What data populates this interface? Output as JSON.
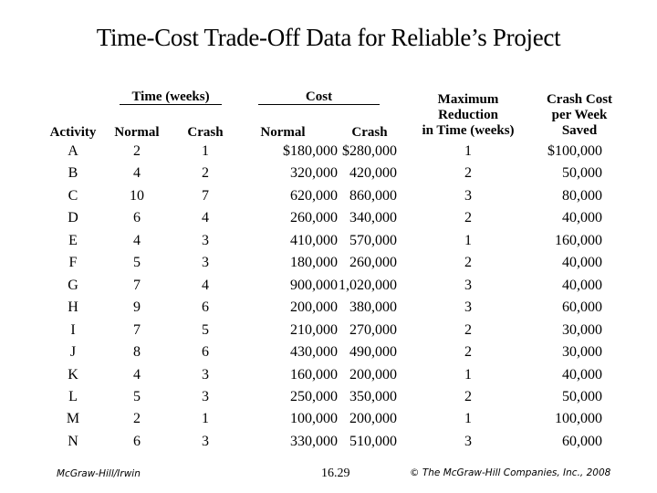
{
  "title": "Time-Cost Trade-Off Data for Reliable’s Project",
  "group_headers": {
    "time": "Time (weeks)",
    "cost": "Cost"
  },
  "column_headers": {
    "activity": "Activity",
    "time_normal": "Normal",
    "time_crash": "Crash",
    "cost_normal": "Normal",
    "cost_crash": "Crash",
    "max_reduction": [
      "Maximum",
      "Reduction",
      "in Time (weeks)"
    ],
    "crash_cost_per_week": [
      "Crash Cost",
      "per Week",
      "Saved"
    ]
  },
  "rows": [
    {
      "activity": "A",
      "time_normal": "2",
      "time_crash": "1",
      "cost_normal": "$180,000",
      "cost_crash": "$280,000",
      "max_reduction": "1",
      "crash_cost_per_week": "$100,000"
    },
    {
      "activity": "B",
      "time_normal": "4",
      "time_crash": "2",
      "cost_normal": "320,000",
      "cost_crash": "420,000",
      "max_reduction": "2",
      "crash_cost_per_week": "50,000"
    },
    {
      "activity": "C",
      "time_normal": "10",
      "time_crash": "7",
      "cost_normal": "620,000",
      "cost_crash": "860,000",
      "max_reduction": "3",
      "crash_cost_per_week": "80,000"
    },
    {
      "activity": "D",
      "time_normal": "6",
      "time_crash": "4",
      "cost_normal": "260,000",
      "cost_crash": "340,000",
      "max_reduction": "2",
      "crash_cost_per_week": "40,000"
    },
    {
      "activity": "E",
      "time_normal": "4",
      "time_crash": "3",
      "cost_normal": "410,000",
      "cost_crash": "570,000",
      "max_reduction": "1",
      "crash_cost_per_week": "160,000"
    },
    {
      "activity": "F",
      "time_normal": "5",
      "time_crash": "3",
      "cost_normal": "180,000",
      "cost_crash": "260,000",
      "max_reduction": "2",
      "crash_cost_per_week": "40,000"
    },
    {
      "activity": "G",
      "time_normal": "7",
      "time_crash": "4",
      "cost_normal": "900,000",
      "cost_crash": "1,020,000",
      "max_reduction": "3",
      "crash_cost_per_week": "40,000"
    },
    {
      "activity": "H",
      "time_normal": "9",
      "time_crash": "6",
      "cost_normal": "200,000",
      "cost_crash": "380,000",
      "max_reduction": "3",
      "crash_cost_per_week": "60,000"
    },
    {
      "activity": "I",
      "time_normal": "7",
      "time_crash": "5",
      "cost_normal": "210,000",
      "cost_crash": "270,000",
      "max_reduction": "2",
      "crash_cost_per_week": "30,000"
    },
    {
      "activity": "J",
      "time_normal": "8",
      "time_crash": "6",
      "cost_normal": "430,000",
      "cost_crash": "490,000",
      "max_reduction": "2",
      "crash_cost_per_week": "30,000"
    },
    {
      "activity": "K",
      "time_normal": "4",
      "time_crash": "3",
      "cost_normal": "160,000",
      "cost_crash": "200,000",
      "max_reduction": "1",
      "crash_cost_per_week": "40,000"
    },
    {
      "activity": "L",
      "time_normal": "5",
      "time_crash": "3",
      "cost_normal": "250,000",
      "cost_crash": "350,000",
      "max_reduction": "2",
      "crash_cost_per_week": "50,000"
    },
    {
      "activity": "M",
      "time_normal": "2",
      "time_crash": "1",
      "cost_normal": "100,000",
      "cost_crash": "200,000",
      "max_reduction": "1",
      "crash_cost_per_week": "100,000"
    },
    {
      "activity": "N",
      "time_normal": "6",
      "time_crash": "3",
      "cost_normal": "330,000",
      "cost_crash": "510,000",
      "max_reduction": "3",
      "crash_cost_per_week": "60,000"
    }
  ],
  "footer": {
    "publisher": "McGraw-Hill/Irwin",
    "page_number": "16.29",
    "copyright": "© The McGraw-Hill Companies, Inc., 2008"
  }
}
